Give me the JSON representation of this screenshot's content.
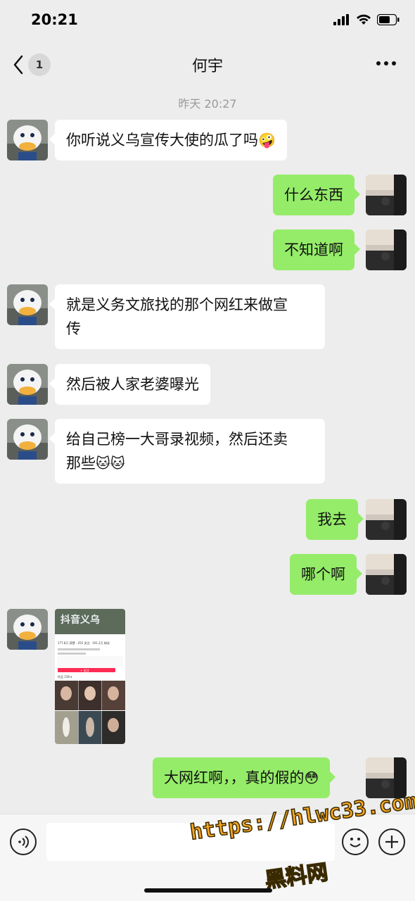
{
  "status_bar": {
    "time": "20:21"
  },
  "nav": {
    "back_count": "1",
    "title": "何宇"
  },
  "chat": {
    "timestamp": "昨天 20:27",
    "messages": [
      {
        "from": "other",
        "text": "你听说义乌宣传大使的瓜了吗",
        "emoji": "🤪"
      },
      {
        "from": "self",
        "text": "什么东西"
      },
      {
        "from": "self",
        "text": "不知道啊"
      },
      {
        "from": "other",
        "line1": "就是义务文旅找的那个网红来做宣",
        "line2": "传"
      },
      {
        "from": "other",
        "text": "然后被人家老婆曝光"
      },
      {
        "from": "other",
        "line1": "给自己榜一大哥录视频，然后还卖",
        "line2": "那些",
        "emoji": "🐱🐱"
      },
      {
        "from": "self",
        "text": "我去"
      },
      {
        "from": "self",
        "text": "哪个啊"
      },
      {
        "from": "other",
        "type": "image"
      },
      {
        "from": "self",
        "text": "大网红啊，，真的假的",
        "emoji": "😳"
      }
    ]
  },
  "image_msg": {
    "title": "抖音义乌",
    "stats": "177.8万 获赞 · 255 关注 · 101.2万 粉丝",
    "button": "+ 关注",
    "tab": "作品 158 ▾"
  },
  "watermark": {
    "url": "https://hlwc33.com",
    "text": "黑料网"
  },
  "colors": {
    "bubble_out": "#95ec69",
    "bubble_in": "#ffffff",
    "background": "#ededed",
    "watermark": "#f5a623"
  }
}
